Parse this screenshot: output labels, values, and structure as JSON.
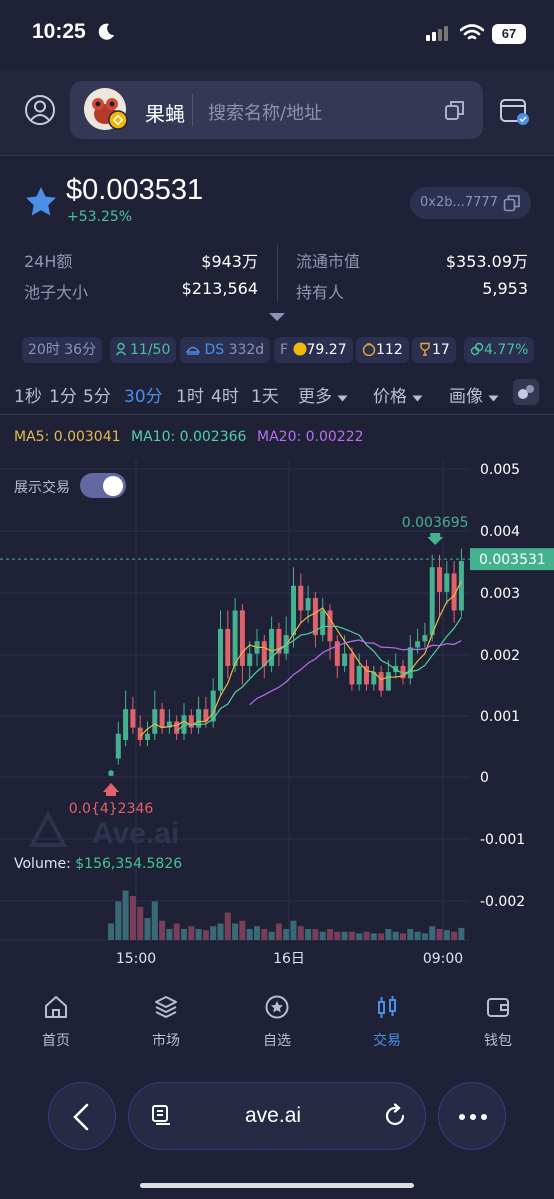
{
  "status_bar": {
    "time": "10:25",
    "battery": "67"
  },
  "header": {
    "token_name": "果蝇",
    "search_placeholder": "搜索名称/地址"
  },
  "token": {
    "price": "$0.003531",
    "change": "+53.25%",
    "address": "0x2b...7777"
  },
  "stats": {
    "volume_24h_label": "24H额",
    "volume_24h_value": "$943万",
    "market_cap_label": "流通市值",
    "market_cap_value": "$353.09万",
    "pool_label": "池子大小",
    "pool_value": "$213,564",
    "holders_label": "持有人",
    "holders_value": "5,953"
  },
  "chips": {
    "age": "20时 36分",
    "users": "11/50",
    "ds": "DS",
    "ds_value": "332d",
    "f_label": "F",
    "score": "79.27",
    "money": "112",
    "trophy": "17",
    "percent": "4.77%"
  },
  "timeframes": [
    "1秒",
    "1分",
    "5分",
    "30分",
    "1时",
    "4时",
    "1天"
  ],
  "timeframe_active": "30分",
  "dropdowns": {
    "more": "更多",
    "price": "价格",
    "drawing": "画像"
  },
  "indicators": {
    "ma5": "MA5: 0.003041",
    "ma10": "MA10: 0.002366",
    "ma20": "MA20: 0.00222"
  },
  "show_trades_label": "展示交易",
  "chart_data": {
    "type": "candlestick",
    "y_ticks": [
      "0.005",
      "0.004",
      "0.003",
      "0.002",
      "0.001",
      "0",
      "-0.001",
      "-0.002"
    ],
    "ylim": [
      -0.0026,
      0.0058
    ],
    "x_ticks": [
      "15:00",
      "16日",
      "09:00"
    ],
    "current_price_label": "0.003531",
    "high_marker": "0.003695",
    "low_marker": "0.0{4}2346",
    "volume_label": "Volume:",
    "volume_value": "$156,354.5826",
    "watermark": "Ave.ai",
    "colors": {
      "up": "#45b18e",
      "down": "#e0626a",
      "ma5": "#e8b84a",
      "ma10": "#4fd1a5",
      "ma20": "#b86ef0"
    }
  },
  "bottom_nav": [
    {
      "label": "首页",
      "icon": "home-icon"
    },
    {
      "label": "市场",
      "icon": "layers-icon"
    },
    {
      "label": "自选",
      "icon": "star-icon"
    },
    {
      "label": "交易",
      "icon": "trade-icon"
    },
    {
      "label": "钱包",
      "icon": "wallet-icon"
    }
  ],
  "browser": {
    "url": "ave.ai"
  }
}
